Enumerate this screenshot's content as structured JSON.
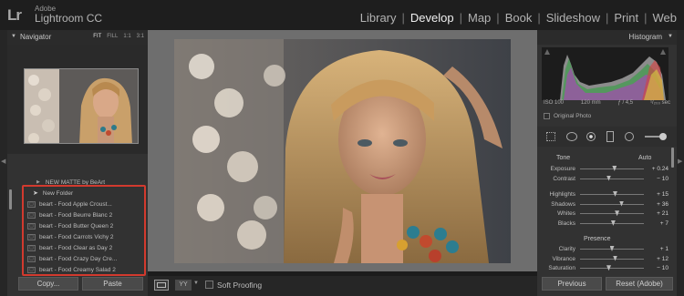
{
  "app": {
    "logo": "Lr",
    "brand_top": "Adobe",
    "brand_name": "Lightroom CC"
  },
  "modules": [
    "Library",
    "Develop",
    "Map",
    "Book",
    "Slideshow",
    "Print",
    "Web"
  ],
  "active_module": "Develop",
  "navigator": {
    "title": "Navigator",
    "options": [
      "FIT",
      "FILL",
      "1:1",
      "3:1"
    ]
  },
  "folders": {
    "top": "NEW MATTE by BeArt",
    "folder": "New Folder",
    "items": [
      "beart - Food Apple Croust...",
      "beart - Food Beurre Blanc 2",
      "beart - Food Butter Queen 2",
      "beart - Food Carrots Vichy 2",
      "beart - Food Clear as Day 2",
      "beart - Food Crazy Day Cre...",
      "beart - Food Creamy Salad 2"
    ]
  },
  "left_buttons": {
    "copy": "Copy...",
    "paste": "Paste"
  },
  "toolbar": {
    "soft_proofing": "Soft Proofing",
    "view_mode": "YY"
  },
  "histogram": {
    "title": "Histogram",
    "iso": "ISO 100",
    "focal": "120 mm",
    "aperture": "ƒ / 4,5",
    "shutter": "¹/₂₀₀ sec",
    "original_photo": "Original Photo"
  },
  "tone": {
    "title": "Tone",
    "auto": "Auto"
  },
  "sliders_tone": [
    {
      "label": "Exposure",
      "value": "+ 0.24",
      "pos": 0.54
    },
    {
      "label": "Contrast",
      "value": "− 10",
      "pos": 0.45
    }
  ],
  "sliders_tone2": [
    {
      "label": "Highlights",
      "value": "+ 15",
      "pos": 0.55
    },
    {
      "label": "Shadows",
      "value": "+ 36",
      "pos": 0.65
    },
    {
      "label": "Whites",
      "value": "+ 21",
      "pos": 0.58
    },
    {
      "label": "Blacks",
      "value": "+ 7",
      "pos": 0.52
    }
  ],
  "presence": {
    "title": "Presence"
  },
  "sliders_presence": [
    {
      "label": "Clarity",
      "value": "+ 1",
      "pos": 0.5
    },
    {
      "label": "Vibrance",
      "value": "+ 12",
      "pos": 0.55
    },
    {
      "label": "Saturation",
      "value": "− 10",
      "pos": 0.45
    }
  ],
  "right_buttons": {
    "previous": "Previous",
    "reset": "Reset (Adobe)"
  }
}
